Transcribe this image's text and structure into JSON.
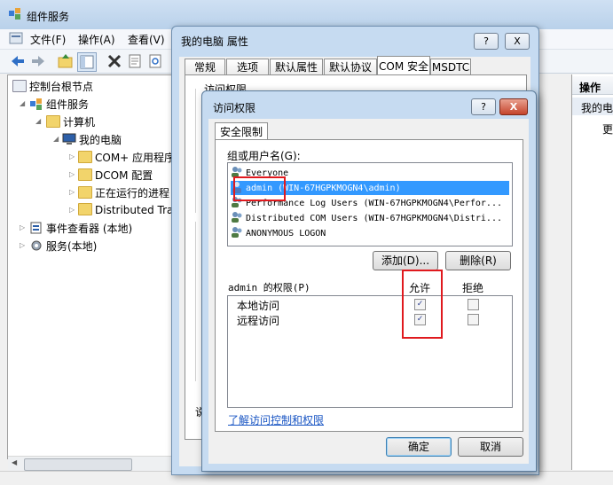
{
  "main_window": {
    "title": "组件服务",
    "menu": [
      "文件(F)",
      "操作(A)",
      "查看(V)"
    ],
    "toolbar_icons": [
      "back-icon",
      "forward-icon",
      "up-folder-icon",
      "show-tree-icon",
      "delete-icon",
      "properties-icon",
      "refresh-icon"
    ],
    "tree": {
      "root": "控制台根节点",
      "component_services": "组件服务",
      "computers": "计算机",
      "my_computer": "我的电脑",
      "children": [
        "COM+ 应用程序",
        "DCOM 配置",
        "正在运行的进程",
        "Distributed Tra"
      ],
      "event_viewer": "事件查看器 (本地)",
      "services": "服务(本地)"
    },
    "right_pane": {
      "header": "操作",
      "item1": "我的电",
      "item2": "更"
    }
  },
  "properties_window": {
    "title": "我的电脑 属性",
    "help_btn": "?",
    "close_btn": "X",
    "tabs": [
      "常规",
      "选项",
      "默认属性",
      "默认协议",
      "COM 安全",
      "MSDTC"
    ],
    "panel_group_label": "访问权限",
    "cut_text": "说"
  },
  "access_dialog": {
    "title": "访问权限",
    "help_btn": "?",
    "close_btn": "X",
    "tab": "安全限制",
    "group_label": "组或用户名(G):",
    "users": [
      {
        "name": "Everyone",
        "selected": false
      },
      {
        "name": "admin (WIN-67HGPKMOGN4\\admin)",
        "selected": true
      },
      {
        "name": "Performance Log Users (WIN-67HGPKMOGN4\\Perfor...",
        "selected": false
      },
      {
        "name": "Distributed COM Users (WIN-67HGPKMOGN4\\Distri...",
        "selected": false
      },
      {
        "name": "ANONYMOUS LOGON",
        "selected": false
      }
    ],
    "add_button": "添加(D)...",
    "remove_button": "删除(R)",
    "perm_label": "admin 的权限(P)",
    "allow_header": "允许",
    "deny_header": "拒绝",
    "permissions": [
      {
        "name": "本地访问",
        "allow": true,
        "deny": false
      },
      {
        "name": "远程访问",
        "allow": true,
        "deny": false
      }
    ],
    "link": "了解访问控制和权限",
    "ok_button": "确定",
    "cancel_button": "取消",
    "check_mark": "✓"
  }
}
